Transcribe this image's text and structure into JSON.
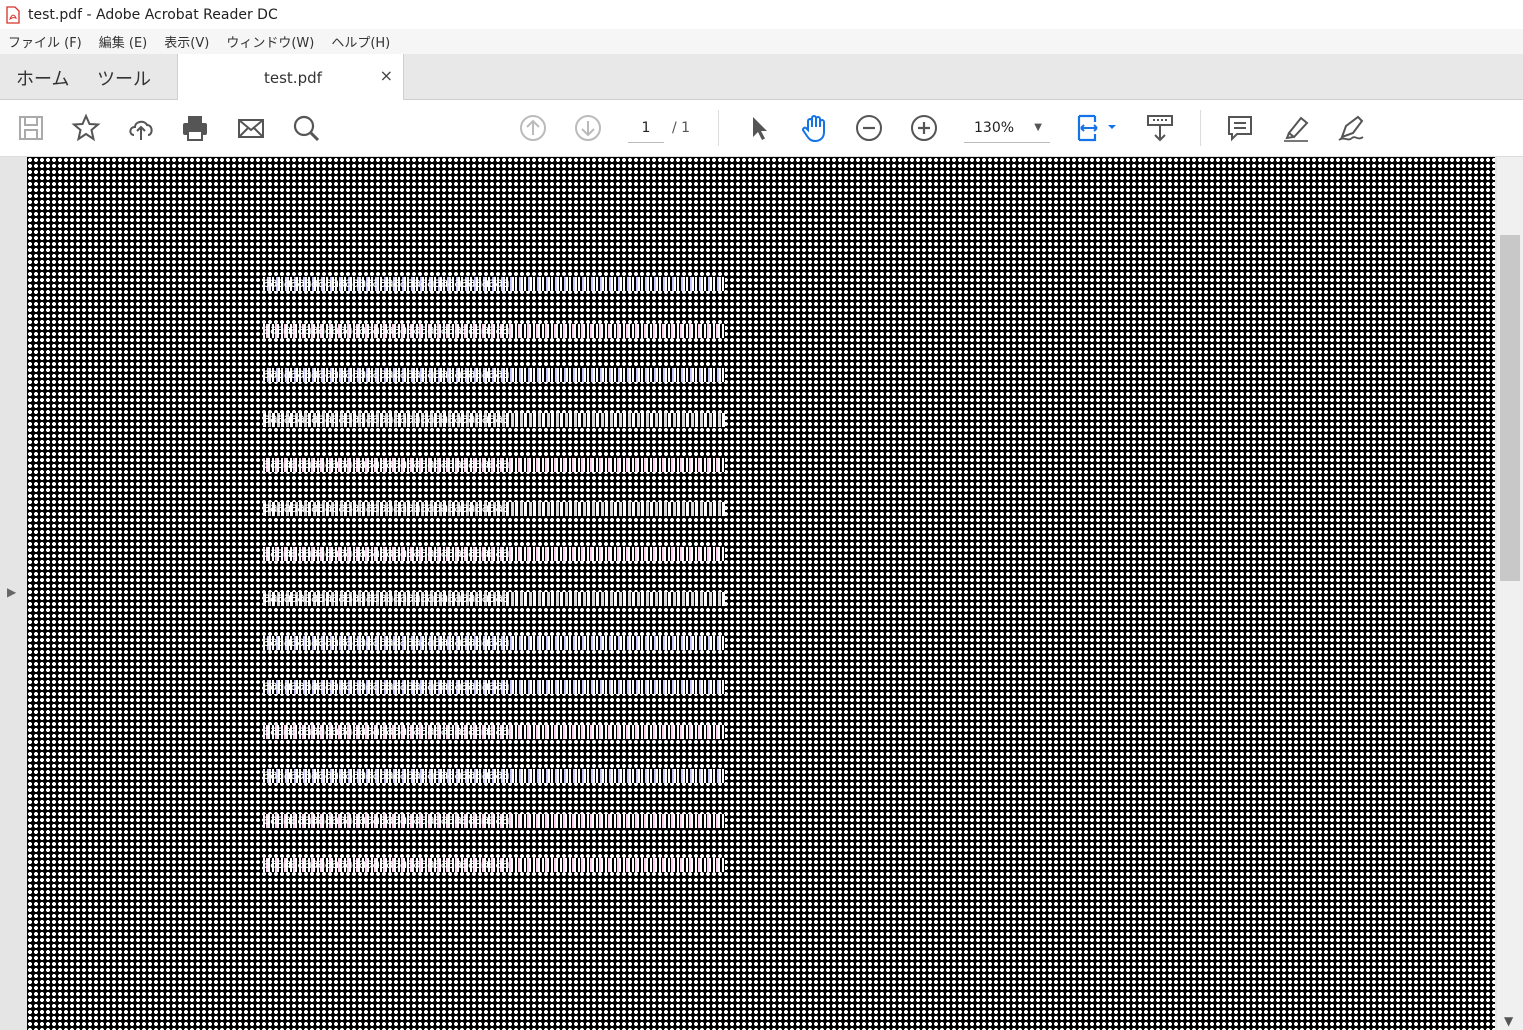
{
  "window": {
    "title": "test.pdf - Adobe Acrobat Reader DC"
  },
  "menu": [
    "ファイル (F)",
    "編集 (E)",
    "表示(V)",
    "ウィンドウ(W)",
    "ヘルプ(H)"
  ],
  "tabs": {
    "home": "ホーム",
    "tools": "ツール",
    "document": "test.pdf",
    "close": "×"
  },
  "toolbar": {
    "page_current": "1",
    "page_total": "/ 1",
    "zoom": "130%"
  },
  "document": {
    "lines": [
      "aaaaaaaaaaaaaaaaaaaaaaaaaaaaaaaaaaaa",
      "aaaaaaaaaaaaaaaaaaaaaaaaaaaaaaaaaaaa",
      "aaaaaaaaaaaaaaaaaaaaaaaaaaaaaaaaaaaa",
      "aaaaaaaaaaaaaaaaaaaaaaaaaaaaaaaaaaaa",
      "aaaaaaaaaaaaaaaaaaaaaaaaaaaaaaaaaaaa",
      "aaaaaaaaaaaaaaaaaaaaaaaaaaaaaaaaaaaa",
      "aaaaaaaaaaaaaaaaaaaaaaaaaaaaaaaaaaaa",
      "aaaaaaaaaaaaaaaaaaaaaaaaaaaaaaaaaaaa",
      "aaaaaaaaaaaaaaaaaaaaaaaaaaaaaaaaaaaa",
      "aaaaaaaaaaaaaaaaaaaaaaaaaaaaaaaaaaaa",
      "aaaaaaaaaaaaaaaaaaaaaaaaaaaaaaaaaaaa",
      "aaaaaaaaaaaaaaaaaaaaaaaaaaaaaaaaaaaa",
      "aaaaaaaaaaaaaaaaaaaaaaaaaaaaaaaaaaaa",
      "aaaaaaaaaaaaaaaaaaaaaaaaaaaaaaaaaaaa"
    ]
  },
  "colors": {
    "accent": "#1473e6",
    "pdf_red": "#d8302a",
    "page_bg": "#000000",
    "icon_gray": "#555555"
  }
}
